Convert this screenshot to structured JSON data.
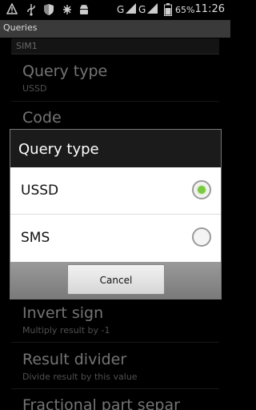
{
  "status_bar": {
    "icons": [
      "warning-icon",
      "usb-icon",
      "shield-icon",
      "debug-icon",
      "android-icon"
    ],
    "network1": "G",
    "network2": "G",
    "battery": "65%",
    "time": "11:26"
  },
  "title_bar": {
    "title": "Queries"
  },
  "background": {
    "section": "SIM1",
    "prefs": [
      {
        "title": "Query type",
        "summary": "USSD"
      },
      {
        "title": "Code",
        "summary": ""
      },
      {
        "title": "Invert sign",
        "summary": "Multiply result by -1"
      },
      {
        "title": "Result divider",
        "summary": "Divide result by this value"
      },
      {
        "title": "Fractional part separ",
        "summary": ""
      }
    ]
  },
  "dialog": {
    "title": "Query type",
    "options": [
      {
        "label": "USSD",
        "selected": true
      },
      {
        "label": "SMS",
        "selected": false
      }
    ],
    "cancel_label": "Cancel"
  },
  "colors": {
    "radio_selected": "#7ac943",
    "dialog_footer": "#8a8a8a"
  }
}
